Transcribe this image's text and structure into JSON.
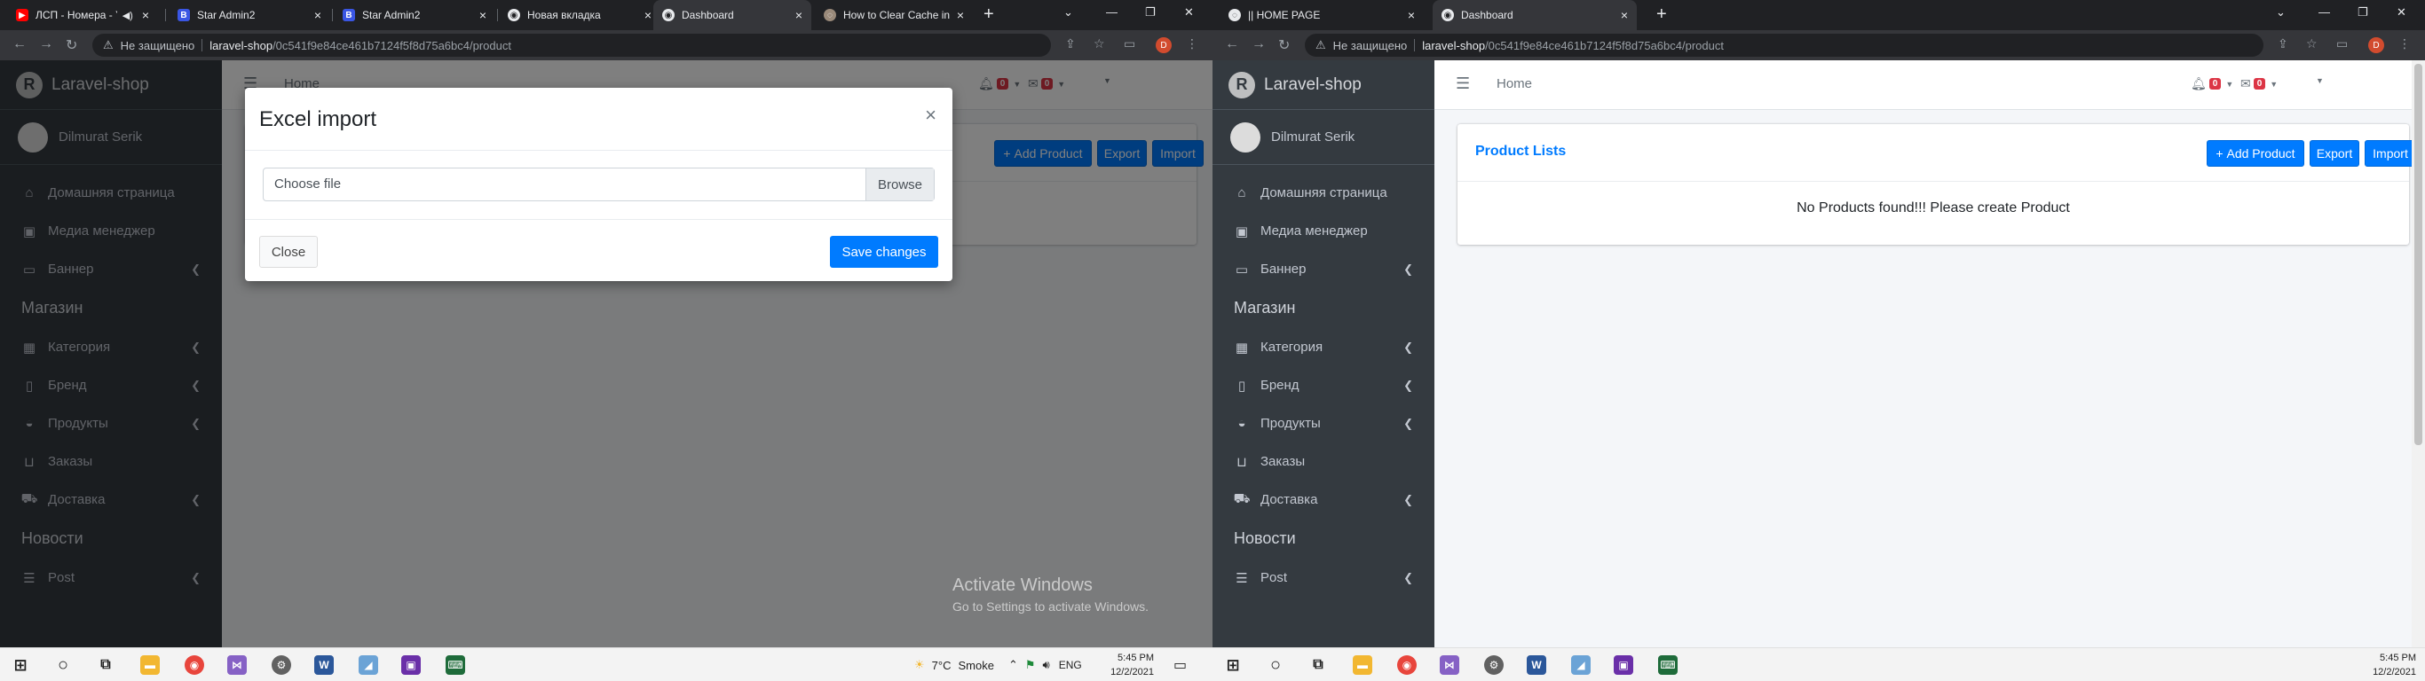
{
  "left": {
    "tabs": [
      {
        "title": "ЛСП - Номера - Y",
        "icon": "youtube-icon"
      },
      {
        "title": "Star Admin2",
        "icon": "b-icon"
      },
      {
        "title": "Star Admin2",
        "icon": "b-icon"
      },
      {
        "title": "Новая вкладка",
        "icon": "chrome-icon"
      },
      {
        "title": "Dashboard",
        "icon": "chrome-icon",
        "active": true
      },
      {
        "title": "How to Clear Cache in",
        "icon": "site-icon"
      }
    ],
    "address": {
      "security": "Не защищено",
      "host": "laravel-shop",
      "path": "/0c541f9e84ce461b7124f5f8d75a6bc4/product"
    },
    "navbar": {
      "home": "Home",
      "bell_count": "0",
      "mail_count": "0"
    },
    "modal": {
      "title": "Excel import",
      "close_glyph": "×",
      "file_placeholder": "Choose file",
      "browse": "Browse",
      "close_button": "Close",
      "save_button": "Save changes"
    },
    "activate": {
      "line1": "Activate Windows",
      "line2": "Go to Settings to activate Windows."
    }
  },
  "right": {
    "tabs": [
      {
        "title": "|| HOME PAGE",
        "icon": "site-icon"
      },
      {
        "title": "Dashboard",
        "icon": "chrome-icon",
        "active": true
      }
    ],
    "address": {
      "security": "Не защищено",
      "host": "laravel-shop",
      "path": "/0c541f9e84ce461b7124f5f8d75a6bc4/product"
    },
    "navbar": {
      "home": "Home",
      "bell_count": "0",
      "mail_count": "0"
    }
  },
  "app": {
    "brand": "Laravel-shop",
    "user": "Dilmurat Serik",
    "menu": [
      {
        "label": "Домашняя страница",
        "icon": "home-icon"
      },
      {
        "label": "Медиа менеджер",
        "icon": "images-icon"
      },
      {
        "label": "Баннер",
        "icon": "desktop-icon",
        "chevron": true
      }
    ],
    "section_shop": "Магазин",
    "shop_menu": [
      {
        "label": "Категория",
        "icon": "grid-icon",
        "chevron": true
      },
      {
        "label": "Бренд",
        "icon": "building-icon",
        "chevron": true
      },
      {
        "label": "Продукты",
        "icon": "hdd-icon",
        "chevron": true
      },
      {
        "label": "Заказы",
        "icon": "basket-icon"
      },
      {
        "label": "Доставка",
        "icon": "truck-icon",
        "chevron": true
      }
    ],
    "section_news": "Новости",
    "news_menu": [
      {
        "label": "Post",
        "icon": "list-icon",
        "chevron": true
      }
    ],
    "card": {
      "title": "Product Lists",
      "add_button": "Add Product",
      "export_button": "Export",
      "import_button": "Import",
      "empty_message": "No Products found!!! Please create Product"
    }
  },
  "taskbar_left": {
    "weather": {
      "temp": "7°C",
      "condition": "Smoke"
    },
    "lang": "ENG",
    "time": "5:45 PM",
    "date": "12/2/2021"
  },
  "taskbar_right": {
    "time": "5:45 PM",
    "date": "12/2/2021"
  },
  "colors": {
    "primary": "#007bff",
    "sidebar": "#343a40",
    "badge": "#dc3545"
  }
}
